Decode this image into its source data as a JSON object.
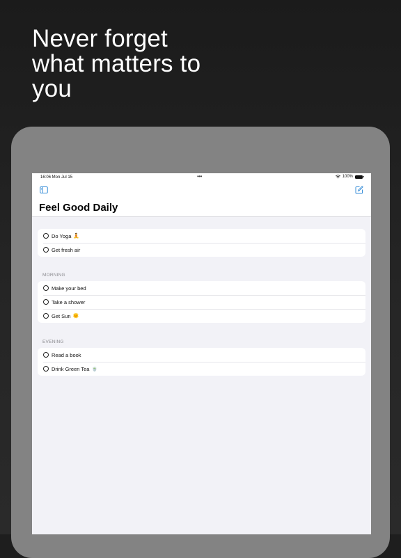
{
  "headline": "Never forget\nwhat matters to\nyou",
  "status_bar": {
    "time": "16:06  Mon Jul 15",
    "dots": "•••",
    "battery": "100%"
  },
  "nav": {
    "sidebar_icon": "sidebar-icon",
    "compose_icon": "compose-icon"
  },
  "title": "Feel Good Daily",
  "accent_color": "#3a8fd8",
  "sections": [
    {
      "header": "",
      "items": [
        {
          "label": "Do Yoga",
          "emoji": "🧘"
        },
        {
          "label": "Get fresh air",
          "emoji": ""
        }
      ]
    },
    {
      "header": "MORNING",
      "items": [
        {
          "label": "Make your bed",
          "emoji": ""
        },
        {
          "label": "Take a shower",
          "emoji": ""
        },
        {
          "label": "Get Sun",
          "emoji": "🌞"
        }
      ]
    },
    {
      "header": "EVENING",
      "items": [
        {
          "label": "Read a book",
          "emoji": ""
        },
        {
          "label": "Drink Green Tea",
          "emoji": "🍵"
        }
      ]
    }
  ]
}
